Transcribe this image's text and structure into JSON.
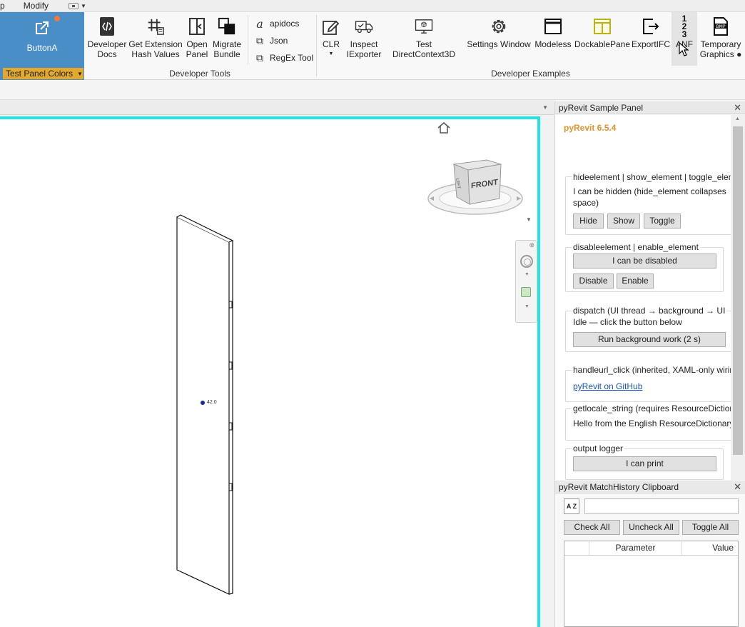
{
  "menu": {
    "left_fragment": "p",
    "modify": "Modify"
  },
  "ribbon": {
    "buttonA": {
      "label": "ButtonA",
      "panel_label": "Test Panel Colors"
    },
    "dev_tools": {
      "buttons": [
        {
          "line1": "Developer",
          "line2": "Docs"
        },
        {
          "line1": "Get Extension",
          "line2": "Hash Values"
        },
        {
          "line1": "Open",
          "line2": "Panel"
        },
        {
          "line1": "Migrate",
          "line2": "Bundle"
        }
      ],
      "small": [
        "apidocs",
        "Json",
        "RegEx Tool"
      ],
      "group_label": "Developer Tools"
    },
    "dev_examples": {
      "clr": "CLR",
      "inspect": {
        "line1": "Inspect",
        "line2": "IExporter"
      },
      "test_dc3d": "Test DirectContext3D",
      "settings_window": "Settings Window",
      "modeless": "Modeless",
      "dockable": "DockablePane",
      "exportifc": "ExportIFC",
      "anf": "ANF",
      "anf_icon": "1 2 3",
      "temp": {
        "line1": "Temporary",
        "line2": "Graphics"
      },
      "group_label": "Developer Examples"
    }
  },
  "view": {
    "dim_label": "42.0",
    "viewcube_face": "FRONT",
    "viewcube_side": "LEFT"
  },
  "sample_panel": {
    "title": "pyRevit Sample Panel",
    "version": "pyRevit 6.5.4",
    "hide_group": {
      "title": "hideelement  |  show_element  |  toggle_element",
      "text1": "I can be hidden (hide_element collapses",
      "text2": "space)",
      "hide": "Hide",
      "show": "Show",
      "toggle": "Toggle"
    },
    "disable_group": {
      "title": "disableelement  |  enable_element",
      "target": "I can be disabled",
      "disable": "Disable",
      "enable": "Enable"
    },
    "dispatch_group": {
      "title": "dispatch  (UI thread → background → UI",
      "status": "Idle — click the button below",
      "run": "Run background work (2 s)"
    },
    "url_group": {
      "title": "handleurl_click  (inherited, XAML-only wiring)",
      "link": "pyRevit on GitHub"
    },
    "locale_group": {
      "title": "getlocale_string  (requires ResourceDictionary)",
      "text": "Hello from the English ResourceDictionary"
    },
    "logger_group": {
      "title": "output logger",
      "button": "I can print"
    }
  },
  "match_panel": {
    "title": "pyRevit MatchHistory Clipboard",
    "filter_icon": "A Z",
    "check_all": "Check All",
    "uncheck_all": "Uncheck All",
    "toggle_all": "Toggle All",
    "col_param": "Parameter",
    "col_value": "Value"
  }
}
